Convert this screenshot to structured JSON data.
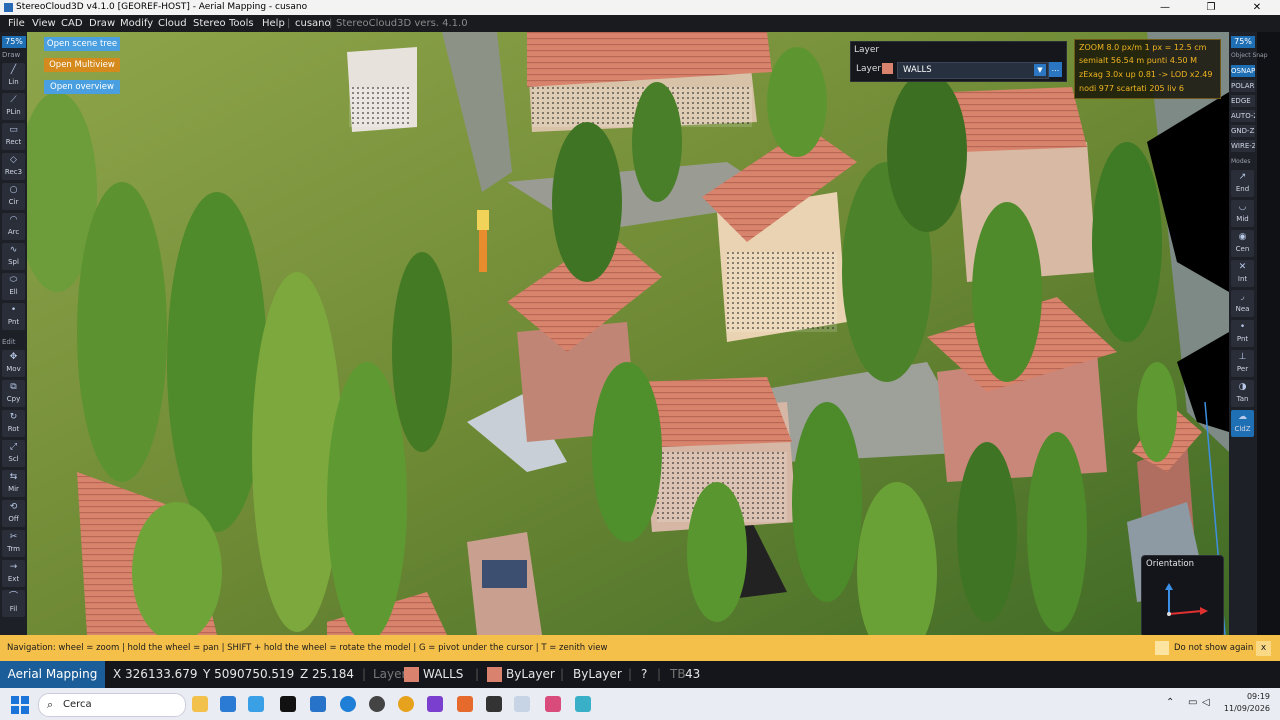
{
  "window": {
    "title": "StereoCloud3D v4.1.0  [GEOREF-HOST] - Aerial Mapping - cusano",
    "minimize": "—",
    "maximize": "❐",
    "close": "✕"
  },
  "menu": {
    "items": [
      "File",
      "View",
      "CAD",
      "Draw",
      "Modify",
      "Cloud",
      "Stereo",
      "Tools",
      "Help"
    ],
    "project": "cusano",
    "version": "StereoCloud3D vers. 4.1.0"
  },
  "left_toolbar": {
    "zoom": "75%",
    "draw_label": "Draw",
    "draw_tools": [
      {
        "label": "Lin",
        "icon": "line-icon"
      },
      {
        "label": "PLin",
        "icon": "polyline-icon"
      },
      {
        "label": "Rect",
        "icon": "rectangle-icon"
      },
      {
        "label": "Rec3",
        "icon": "rect3-icon"
      },
      {
        "label": "Cir",
        "icon": "circle-icon"
      },
      {
        "label": "Arc",
        "icon": "arc-icon"
      },
      {
        "label": "Spl",
        "icon": "spline-icon"
      },
      {
        "label": "Ell",
        "icon": "ellipse-icon"
      },
      {
        "label": "Pnt",
        "icon": "point-icon"
      }
    ],
    "edit_label": "Edit",
    "edit_tools": [
      {
        "label": "Mov",
        "icon": "move-icon"
      },
      {
        "label": "Cpy",
        "icon": "copy-icon"
      },
      {
        "label": "Rot",
        "icon": "rotate-icon"
      },
      {
        "label": "Scl",
        "icon": "scale-icon"
      },
      {
        "label": "Mir",
        "icon": "mirror-icon"
      },
      {
        "label": "Off",
        "icon": "offset-icon"
      },
      {
        "label": "Trm",
        "icon": "trim-icon"
      },
      {
        "label": "Ext",
        "icon": "extend-icon"
      },
      {
        "label": "Fil",
        "icon": "fillet-icon"
      }
    ]
  },
  "right_toolbar": {
    "zoom": "75%",
    "snap_label": "Object Snap",
    "snap_buttons": [
      "OSNAP",
      "POLAR",
      "EDGE",
      "AUTO-Z",
      "GND-Z",
      "WIRE-Z"
    ],
    "modes_label": "Modes",
    "modes": [
      {
        "label": "End",
        "icon": "endpoint-icon"
      },
      {
        "label": "Mid",
        "icon": "midpoint-icon"
      },
      {
        "label": "Cen",
        "icon": "center-icon"
      },
      {
        "label": "Int",
        "icon": "intersection-icon"
      },
      {
        "label": "Nea",
        "icon": "nearest-icon"
      },
      {
        "label": "Pnt",
        "icon": "node-icon"
      },
      {
        "label": "Per",
        "icon": "perpendicular-icon"
      },
      {
        "label": "Tan",
        "icon": "tangent-icon"
      },
      {
        "label": "CldZ",
        "icon": "cloud-z-icon"
      }
    ]
  },
  "overlay_buttons": {
    "scene_tree": "Open scene tree",
    "multiview": "Open Multiview",
    "overview": "Open overview"
  },
  "layer_panel": {
    "title": "Layer",
    "label": "Layer",
    "value": "WALLS",
    "swatch_color": "#d9826e",
    "more": "..."
  },
  "info": {
    "line1": "ZOOM  8.0 px/m      1 px = 12.5 cm",
    "line2": "semialt 56.54 m        punti 4.50 M",
    "line3": "zExag 3.0x   up 0.81  ->  LOD x2.49",
    "line4": "nodi 977   scartati 205   liv 6"
  },
  "orientation": {
    "title": "Orientation"
  },
  "nav_hint": {
    "text": "Navigation:  wheel = zoom    |  hold the wheel = pan    |  SHIFT + hold the wheel = rotate the model    |  G = pivot under the cursor    |  T = zenith view",
    "dont_show": "Do not show again",
    "close": "x"
  },
  "status": {
    "app": "Aerial Mapping",
    "x": "X 326133.679",
    "y": "Y 5090750.519",
    "z": "Z 25.184",
    "layer_label": "Layer",
    "layer": "WALLS",
    "color": "ByLayer",
    "linetype": "ByLayer",
    "help": "?",
    "tb_prefix": "TB",
    "tb_value": "43"
  },
  "taskbar": {
    "search": "Cerca",
    "time": "09:19",
    "date": "11/09/2026"
  }
}
